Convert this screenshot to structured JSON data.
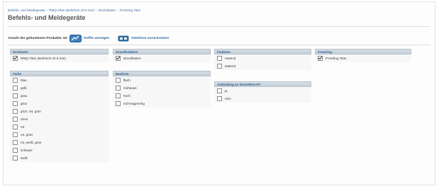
{
  "breadcrumb": [
    "Befehls- und Meldegeräte",
    "RMQ-Titan (Bohrloch 22.5 mm)",
    "Druckfasten",
    "Frontring Titan"
  ],
  "page_title": "Befehls- und Meldegeräte",
  "results": {
    "count_label": "Anzahl der gefundenen Produkte: 53",
    "show_label": "Treffer anzeigen",
    "reset_label": "Selektion zurücksetzen"
  },
  "panels": {
    "sortiment": {
      "title": "Sortiment",
      "options": [
        {
          "label": "RMQ-Titan (Bohrloch 22.5 mm)",
          "checked": true
        }
      ]
    },
    "farbe": {
      "title": "Farbe",
      "options": [
        {
          "label": "blau",
          "checked": false
        },
        {
          "label": "gelb",
          "checked": false
        },
        {
          "label": "grau",
          "checked": false
        },
        {
          "label": "grün",
          "checked": false
        },
        {
          "label": "grün, rot, grün",
          "checked": false
        },
        {
          "label": "ohne",
          "checked": false
        },
        {
          "label": "rot",
          "checked": false
        },
        {
          "label": "rot, grün",
          "checked": false
        },
        {
          "label": "rot, weiß, grün",
          "checked": false
        },
        {
          "label": "schwarz",
          "checked": false
        },
        {
          "label": "weiß",
          "checked": false
        }
      ]
    },
    "grundfunktion": {
      "title": "Grundfunktion",
      "options": [
        {
          "label": "Druckfasten",
          "checked": true
        }
      ]
    },
    "bauform": {
      "title": "Bauform",
      "options": [
        {
          "label": "flach",
          "checked": false
        },
        {
          "label": "Gehäuse",
          "checked": false
        },
        {
          "label": "hoch",
          "checked": false
        },
        {
          "label": "mit Kragenring",
          "checked": false
        }
      ]
    },
    "funktion": {
      "title": "Funktion",
      "options": [
        {
          "label": "rastend",
          "checked": false
        },
        {
          "label": "tastend",
          "checked": false
        }
      ]
    },
    "anbindung": {
      "title": "Anbindung an SmartWire-DT",
      "options": [
        {
          "label": "ja",
          "checked": false
        },
        {
          "label": "nein",
          "checked": false
        }
      ]
    },
    "frontring": {
      "title": "Frontring",
      "options": [
        {
          "label": "Frontring Titan",
          "checked": true
        }
      ]
    }
  }
}
